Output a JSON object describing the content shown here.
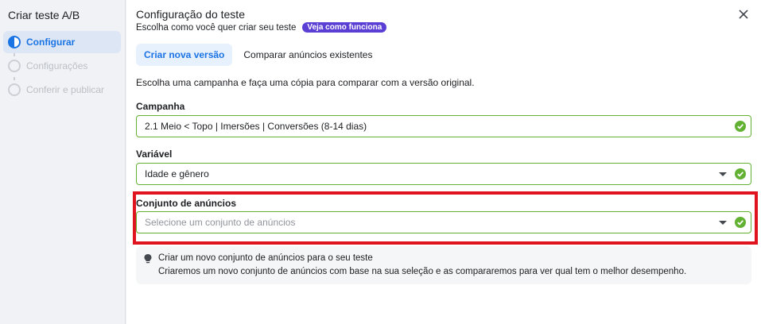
{
  "sidebar": {
    "title": "Criar teste A/B",
    "steps": [
      {
        "label": "Configurar",
        "state": "active"
      },
      {
        "label": "Configurações",
        "state": "inactive"
      },
      {
        "label": "Conferir e publicar",
        "state": "inactive"
      }
    ]
  },
  "header": {
    "title": "Configuração do teste",
    "subtitle": "Escolha como você quer criar seu teste",
    "badge": "Veja como funciona",
    "close_icon": "close-icon"
  },
  "tabs": [
    {
      "label": "Criar nova versão",
      "active": true
    },
    {
      "label": "Comparar anúncios existentes",
      "active": false
    }
  ],
  "description": "Escolha uma campanha e faça uma cópia para comparar com a versão original.",
  "fields": {
    "campaign": {
      "label": "Campanha",
      "value": "2.1 Meio < Topo | Imersões | Conversões (8-14 dias)"
    },
    "variable": {
      "label": "Variável",
      "value": "Idade e gênero"
    },
    "adset": {
      "label": "Conjunto de anúncios",
      "placeholder": "Selecione um conjunto de anúncios"
    }
  },
  "info": {
    "icon": "lightbulb-icon",
    "title": "Criar um novo conjunto de anúncios para o seu teste",
    "text": "Criaremos um novo conjunto de anúncios com base na sua seleção e as compararemos para ver qual tem o melhor desempenho."
  },
  "colors": {
    "accent": "#1b74e4",
    "success": "#63b132",
    "badge": "#5b3fd4",
    "highlight": "#e0141e"
  }
}
